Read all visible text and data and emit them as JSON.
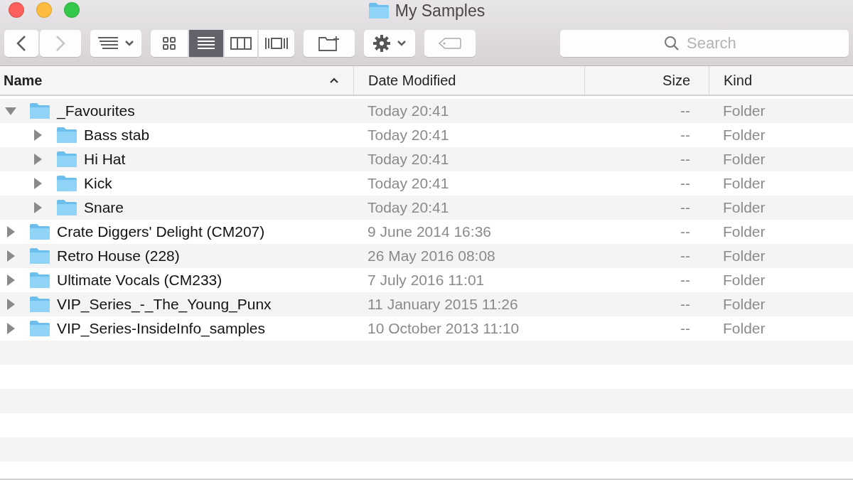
{
  "window": {
    "title": "My Samples"
  },
  "toolbar": {
    "back": {
      "disabled": false
    },
    "forward": {
      "disabled": true
    },
    "views": [
      {
        "kind": "icons",
        "selected": false
      },
      {
        "kind": "list",
        "selected": true
      },
      {
        "kind": "columns",
        "selected": false
      },
      {
        "kind": "coverflow",
        "selected": false
      }
    ],
    "search": {
      "placeholder": "Search"
    }
  },
  "table": {
    "columns": [
      {
        "label": "Name",
        "sort_ascending": true
      },
      {
        "label": "Date Modified"
      },
      {
        "label": "Size"
      },
      {
        "label": "Kind"
      }
    ],
    "rows": [
      {
        "name": "_Favourites",
        "date": "Today 20:41",
        "size": "--",
        "kind": "Folder",
        "expanded": true,
        "children": [
          {
            "name": "Bass stab",
            "date": "Today 20:41",
            "size": "--",
            "kind": "Folder",
            "expanded": false
          },
          {
            "name": "Hi Hat",
            "date": "Today 20:41",
            "size": "--",
            "kind": "Folder",
            "expanded": false
          },
          {
            "name": "Kick",
            "date": "Today 20:41",
            "size": "--",
            "kind": "Folder",
            "expanded": false
          },
          {
            "name": "Snare",
            "date": "Today 20:41",
            "size": "--",
            "kind": "Folder",
            "expanded": false
          }
        ]
      },
      {
        "name": "Crate Diggers' Delight (CM207)",
        "date": "9 June 2014 16:36",
        "size": "--",
        "kind": "Folder",
        "expanded": false
      },
      {
        "name": "Retro House (228)",
        "date": "26 May 2016 08:08",
        "size": "--",
        "kind": "Folder",
        "expanded": false
      },
      {
        "name": "Ultimate Vocals (CM233)",
        "date": "7 July 2016 11:01",
        "size": "--",
        "kind": "Folder",
        "expanded": false
      },
      {
        "name": "VIP_Series_-_The_Young_Punx",
        "date": "11 January 2015 11:26",
        "size": "--",
        "kind": "Folder",
        "expanded": false
      },
      {
        "name": "VIP_Series-InsideInfo_samples",
        "date": "10 October 2013 11:10",
        "size": "--",
        "kind": "Folder",
        "expanded": false
      }
    ]
  }
}
